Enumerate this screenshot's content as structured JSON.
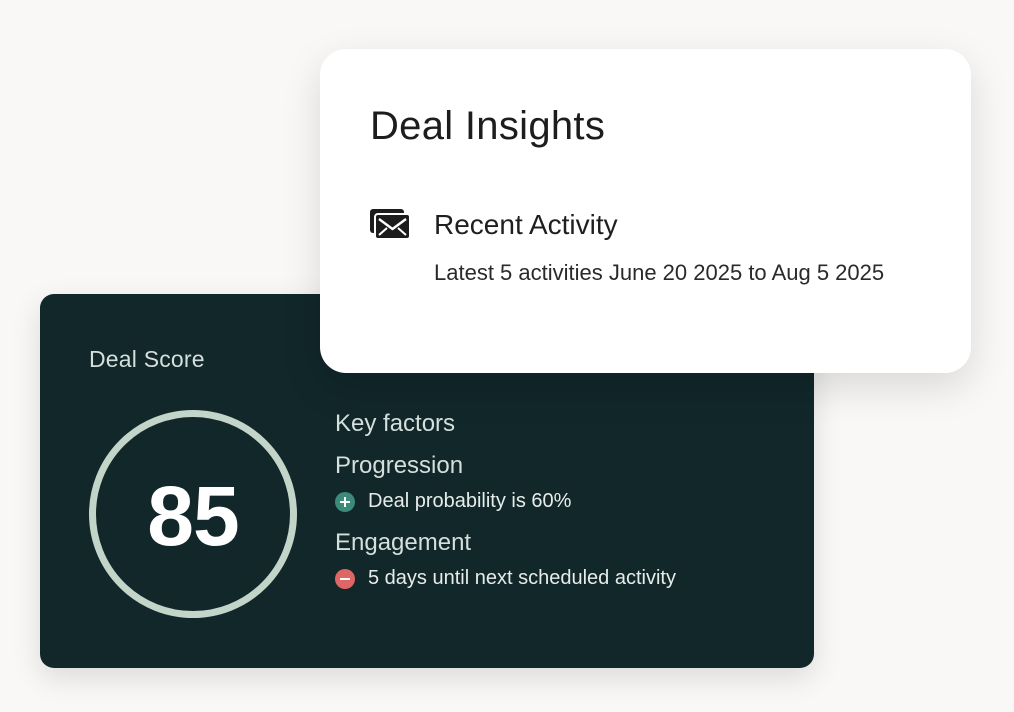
{
  "deal_score": {
    "label": "Deal Score",
    "value": "85",
    "key_factors_label": "Key factors",
    "factors": [
      {
        "heading": "Progression",
        "sentiment": "positive",
        "icon": "plus-circle-icon",
        "text": "Deal probability is 60%"
      },
      {
        "heading": "Engagement",
        "sentiment": "negative",
        "icon": "minus-circle-icon",
        "text": "5 days until next scheduled activity"
      }
    ]
  },
  "insights": {
    "title": "Deal Insights",
    "activity_icon": "envelope-icon",
    "activity_title": "Recent Activity",
    "activity_description": "Latest 5 activities June 20 2025 to Aug 5 2025"
  },
  "colors": {
    "page_background": "#f9f8f6",
    "score_card_background": "#11272a",
    "score_ring": "#c3d5c8",
    "positive": "#3b8a7a",
    "negative": "#e06565",
    "insights_card_background": "#ffffff"
  }
}
